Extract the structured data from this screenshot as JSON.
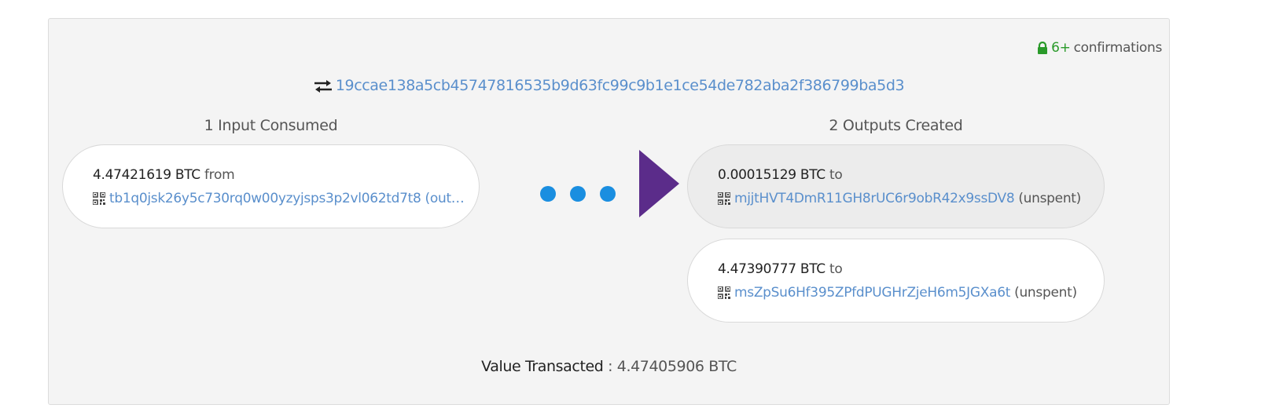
{
  "transaction": {
    "confirmations_count": "6+",
    "confirmations_label": "confirmations",
    "txid": "19ccae138a5cb45747816535b9d63fc99c9b1e1ce54de782aba2f386799ba5d3",
    "inputs_title": "1 Input Consumed",
    "outputs_title": "2 Outputs Created",
    "inputs": [
      {
        "amount": "4.47421619 BTC",
        "direction": "from",
        "address": "tb1q0jsk26y5c730rq0w00yzyjsps3p2vl062td7t8",
        "suffix": "(out…"
      }
    ],
    "outputs": [
      {
        "amount": "0.00015129 BTC",
        "direction": "to",
        "address": "mjjtHVT4DmR11GH8rUC6r9obR42x9ssDV8",
        "status": "(unspent)"
      },
      {
        "amount": "4.47390777 BTC",
        "direction": "to",
        "address": "msZpSu6Hf395ZPfdPUGHrZjeH6m5JGXa6t",
        "status": "(unspent)"
      }
    ],
    "value_label": "Value Transacted",
    "value_separator": ":",
    "value_amount": "4.47405906 BTC"
  },
  "colors": {
    "link": "#5a8fcc",
    "confirm_green": "#2a9a2a",
    "dots": "#1a8ee0",
    "arrow": "#5b2c8a"
  },
  "icons": [
    "lock-icon",
    "swap-arrows-icon",
    "qr-code-icon",
    "flow-dots-icon",
    "flow-arrow-icon"
  ]
}
